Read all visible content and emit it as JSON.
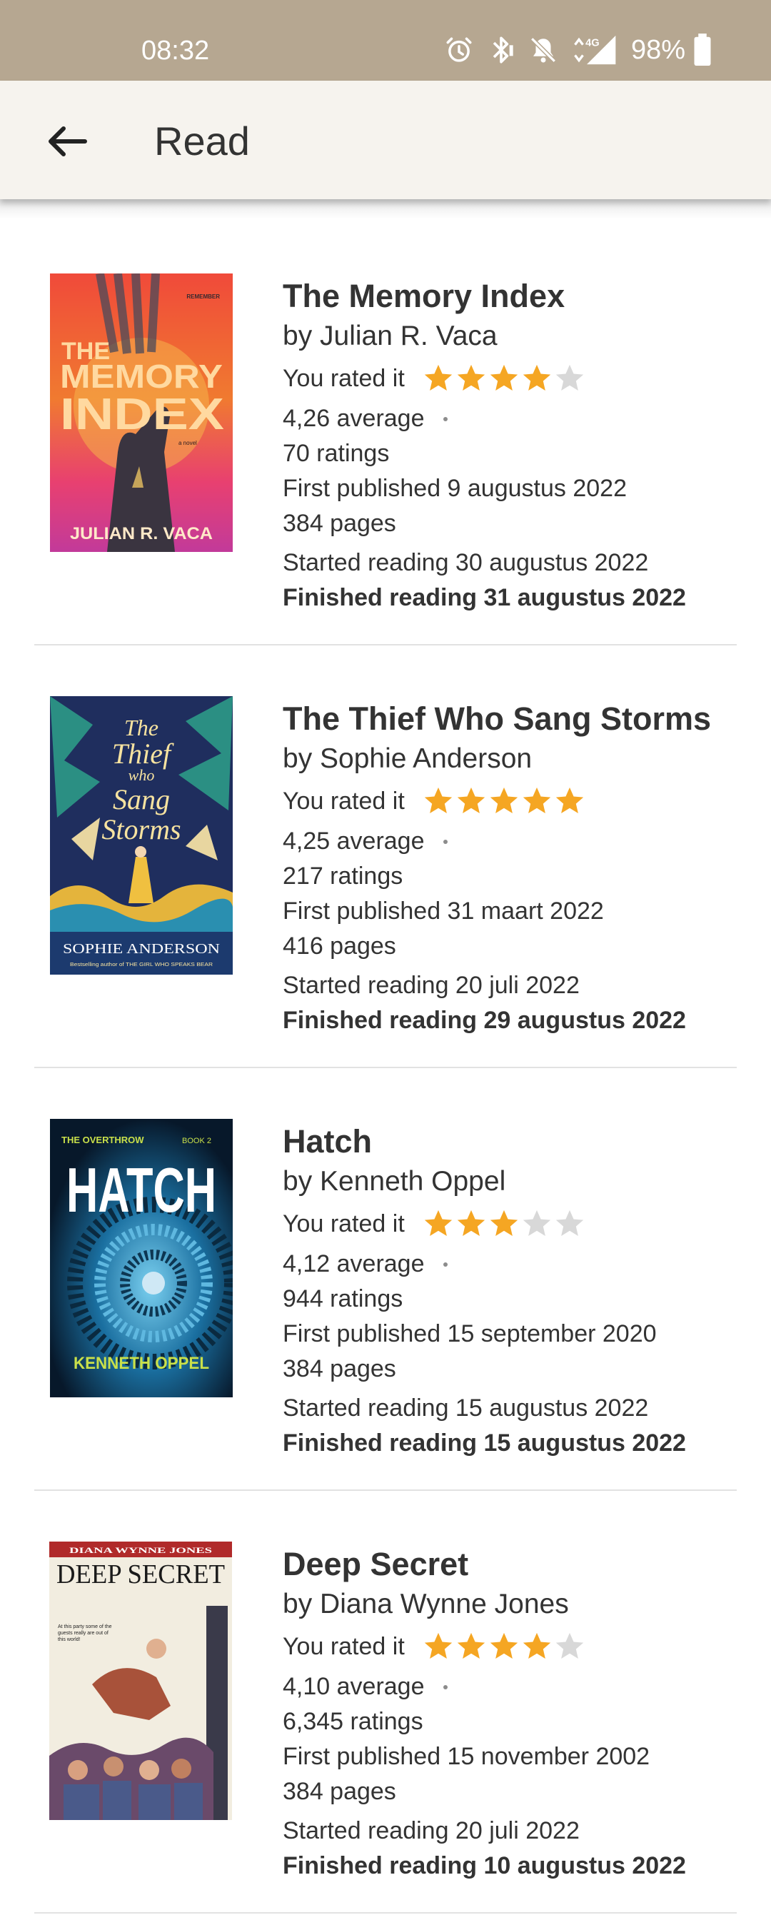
{
  "status_bar": {
    "time": "08:32",
    "network": "4G",
    "battery_percent": "98%",
    "icons": [
      "alarm-icon",
      "bluetooth-icon",
      "notifications-off-icon",
      "signal-4g-icon",
      "battery-icon"
    ]
  },
  "app_bar": {
    "title": "Read",
    "back_icon": "arrow-left-icon"
  },
  "colors": {
    "status_bar": "#b6a791",
    "app_bar": "#f6f3ee",
    "star_filled": "#f5a623",
    "star_empty": "#d8d8d8",
    "text": "#333333"
  },
  "rating_label": "You rated it",
  "books": [
    {
      "title": "The Memory Index",
      "author": "by Julian R. Vaca",
      "rating": 4,
      "average": "4,26 average",
      "ratings": "70 ratings",
      "published": "First published 9 augustus 2022",
      "pages": "384 pages",
      "started": "Started reading 30 augustus 2022",
      "finished": "Finished reading 31 augustus 2022",
      "cover": {
        "title_line1": "THE",
        "title_line2": "MEMORY",
        "title_line3": "INDEX",
        "tagline": "REMEMBER WHAT IT'S LIKE TO REMEMBER",
        "label": "a novel",
        "author": "JULIAN R. VACA"
      }
    },
    {
      "title": "The Thief Who Sang Storms",
      "author": "by Sophie Anderson",
      "rating": 5,
      "average": "4,25 average",
      "ratings": "217 ratings",
      "published": "First published 31 maart 2022",
      "pages": "416 pages",
      "started": "Started reading 20 juli 2022",
      "finished": "Finished reading 29 augustus 2022",
      "cover": {
        "title_line1": "The",
        "title_line2": "Thief",
        "title_line3": "who",
        "title_line4": "Sang",
        "title_line5": "Storms",
        "author": "SOPHIE ANDERSON",
        "tagline": "Bestselling author of THE GIRL WHO SPEAKS BEAR"
      }
    },
    {
      "title": "Hatch",
      "author": "by Kenneth Oppel",
      "rating": 3,
      "average": "4,12 average",
      "ratings": "944 ratings",
      "published": "First published 15 september 2020",
      "pages": "384 pages",
      "started": "Started reading 15 augustus 2022",
      "finished": "Finished reading 15 augustus 2022",
      "cover": {
        "series": "THE OVERTHROW",
        "book": "BOOK 2",
        "title_line1": "HATCH",
        "author": "KENNETH OPPEL"
      }
    },
    {
      "title": "Deep Secret",
      "author": "by Diana Wynne Jones",
      "rating": 4,
      "average": "4,10 average",
      "ratings": "6,345 ratings",
      "published": "First published 15 november 2002",
      "pages": "384 pages",
      "started": "Started reading 20 juli 2022",
      "finished": "Finished reading 10 augustus 2022",
      "cover": {
        "author": "DIANA WYNNE JONES",
        "title_line1": "DEEP SECRET",
        "tagline": "At this party some of the guests really are out of this world!"
      }
    }
  ]
}
